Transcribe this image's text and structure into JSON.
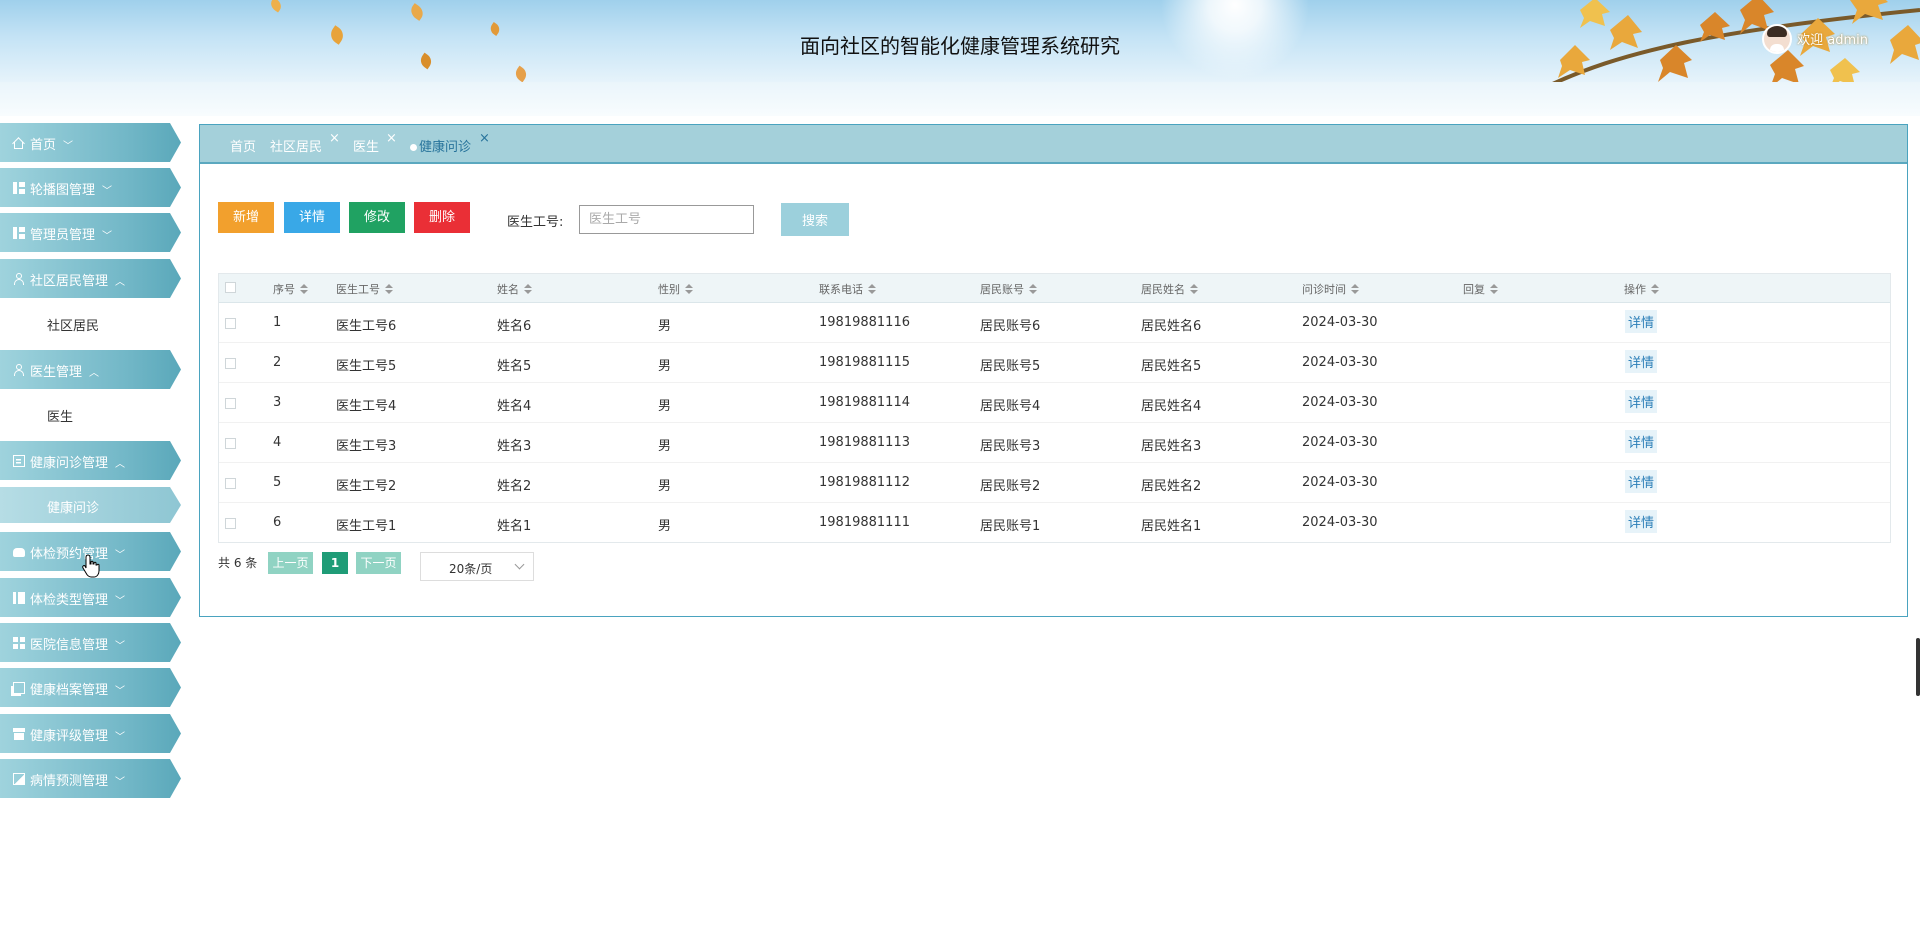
{
  "header": {
    "title": "面向社区的智能化健康管理系统研究",
    "welcome": "欢迎 admin"
  },
  "sidebar": {
    "items": [
      {
        "label": "首页",
        "icon": "home-icon",
        "expanded": false
      },
      {
        "label": "轮播图管理",
        "icon": "grid-icon",
        "expanded": false
      },
      {
        "label": "管理员管理",
        "icon": "grid-icon",
        "expanded": false
      },
      {
        "label": "社区居民管理",
        "icon": "headset-icon",
        "expanded": true,
        "sub": "社区居民"
      },
      {
        "label": "医生管理",
        "icon": "person-icon",
        "expanded": true,
        "sub": "医生"
      },
      {
        "label": "健康问诊管理",
        "icon": "document-icon",
        "expanded": true,
        "sub": "健康问诊"
      },
      {
        "label": "体检预约管理",
        "icon": "car-icon",
        "expanded": false
      },
      {
        "label": "体检类型管理",
        "icon": "columns-icon",
        "expanded": false
      },
      {
        "label": "医院信息管理",
        "icon": "grid-icon",
        "expanded": false
      },
      {
        "label": "健康档案管理",
        "icon": "copy-icon",
        "expanded": false
      },
      {
        "label": "健康评级管理",
        "icon": "box-icon",
        "expanded": false
      },
      {
        "label": "病情预测管理",
        "icon": "image-icon",
        "expanded": false
      }
    ]
  },
  "tabs": [
    {
      "label": "首页",
      "closable": false
    },
    {
      "label": "社区居民",
      "closable": true
    },
    {
      "label": "医生",
      "closable": true
    },
    {
      "label": "健康问诊",
      "closable": true,
      "active": true
    }
  ],
  "toolbar": {
    "add_label": "新增",
    "detail_label": "详情",
    "edit_label": "修改",
    "delete_label": "删除",
    "search_label": "医生工号:",
    "search_placeholder": "医生工号",
    "search_button": "搜索"
  },
  "table": {
    "columns": [
      "序号",
      "医生工号",
      "姓名",
      "性别",
      "联系电话",
      "居民账号",
      "居民姓名",
      "问诊时间",
      "回复",
      "操作"
    ],
    "rows": [
      {
        "no": "1",
        "doctor_id": "医生工号6",
        "name": "姓名6",
        "gender": "男",
        "phone": "19819881116",
        "resident_account": "居民账号6",
        "resident_name": "居民姓名6",
        "time": "2024-03-30",
        "reply": "",
        "action": "详情"
      },
      {
        "no": "2",
        "doctor_id": "医生工号5",
        "name": "姓名5",
        "gender": "男",
        "phone": "19819881115",
        "resident_account": "居民账号5",
        "resident_name": "居民姓名5",
        "time": "2024-03-30",
        "reply": "",
        "action": "详情"
      },
      {
        "no": "3",
        "doctor_id": "医生工号4",
        "name": "姓名4",
        "gender": "男",
        "phone": "19819881114",
        "resident_account": "居民账号4",
        "resident_name": "居民姓名4",
        "time": "2024-03-30",
        "reply": "",
        "action": "详情"
      },
      {
        "no": "4",
        "doctor_id": "医生工号3",
        "name": "姓名3",
        "gender": "男",
        "phone": "19819881113",
        "resident_account": "居民账号3",
        "resident_name": "居民姓名3",
        "time": "2024-03-30",
        "reply": "",
        "action": "详情"
      },
      {
        "no": "5",
        "doctor_id": "医生工号2",
        "name": "姓名2",
        "gender": "男",
        "phone": "19819881112",
        "resident_account": "居民账号2",
        "resident_name": "居民姓名2",
        "time": "2024-03-30",
        "reply": "",
        "action": "详情"
      },
      {
        "no": "6",
        "doctor_id": "医生工号1",
        "name": "姓名1",
        "gender": "男",
        "phone": "19819881111",
        "resident_account": "居民账号1",
        "resident_name": "居民姓名1",
        "time": "2024-03-30",
        "reply": "",
        "action": "详情"
      }
    ]
  },
  "pagination": {
    "total": "共 6 条",
    "prev": "上一页",
    "page": "1",
    "next": "下一页",
    "page_size": "20条/页"
  },
  "colors": {
    "accent": "#72b7c7",
    "add": "#f2a02d",
    "detail": "#39a8e7",
    "edit": "#20a262",
    "delete": "#ea2f36",
    "page_active": "#1f9c77"
  }
}
